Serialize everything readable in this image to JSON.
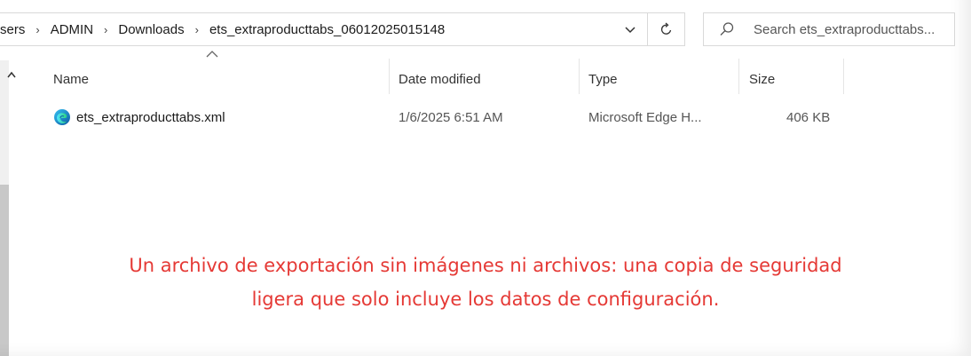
{
  "address": {
    "crumbs": [
      "sers",
      "ADMIN",
      "Downloads",
      "ets_extraproducttabs_06012025015148"
    ],
    "separator": "›"
  },
  "search": {
    "placeholder": "Search ets_extraproducttabs..."
  },
  "columns": {
    "name": "Name",
    "date": "Date modified",
    "type": "Type",
    "size": "Size"
  },
  "files": [
    {
      "name": "ets_extraproducttabs.xml",
      "date": "1/6/2025 6:51 AM",
      "type": "Microsoft Edge H...",
      "size": "406 KB",
      "icon": "edge-icon"
    }
  ],
  "caption": {
    "line1": "Un archivo de exportación sin imágenes ni archivos: una copia de seguridad",
    "line2": "ligera que solo incluye los datos de configuración."
  },
  "colors": {
    "caption": "#e53935",
    "border": "#d9d9d9"
  }
}
